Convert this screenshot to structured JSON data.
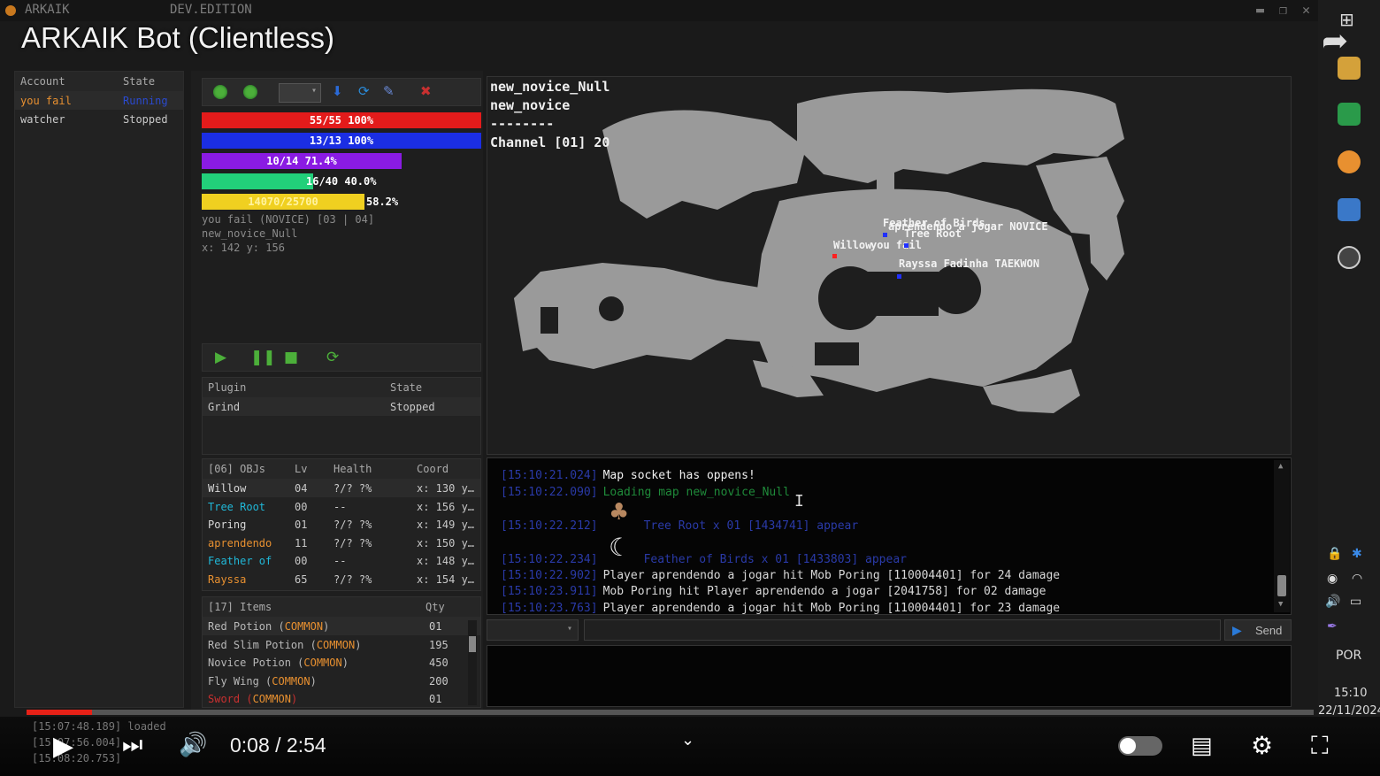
{
  "window": {
    "app_name": "ARKAIK",
    "edition": "DEV.EDITION",
    "video_title": "ARKAIK Bot (Clientless)"
  },
  "accounts": {
    "headers": [
      "Account",
      "State"
    ],
    "rows": [
      {
        "name": "you fail",
        "state": "Running"
      },
      {
        "name": "watcher",
        "state": "Stopped"
      }
    ]
  },
  "status": {
    "hp": "55/55 100%",
    "sp": "13/13 100%",
    "bar3": "10/14 71.4%",
    "bar3_fraction": 0.714,
    "bar4": "16/40 40.0%",
    "bar4_fraction": 0.4,
    "exp_partial": "14070/25700",
    "exp_pct": "58.2%",
    "exp_fraction": 0.582,
    "char_line": "you fail (NOVICE) [03 | 04]",
    "map_line": "new_novice_Null",
    "coords": "x: 142 y: 156"
  },
  "plugins": {
    "headers": [
      "Plugin",
      "State"
    ],
    "rows": [
      {
        "name": "Grind",
        "state": "Stopped"
      }
    ]
  },
  "objects": {
    "headers": [
      "[06] OBJs",
      "Lv",
      "Health",
      "Coord"
    ],
    "rows": [
      {
        "name": "Willow",
        "lv": "04",
        "health": "?/? ?%",
        "coord": "x: 130 y…",
        "color": "#d8d8d8"
      },
      {
        "name": "Tree Root",
        "lv": "00",
        "health": "--",
        "coord": "x: 156 y…",
        "color": "#20b8d8"
      },
      {
        "name": "Poring",
        "lv": "01",
        "health": "?/? ?%",
        "coord": "x: 149 y…",
        "color": "#d8d8d8"
      },
      {
        "name": "aprendendo",
        "lv": "11",
        "health": "?/? ?%",
        "coord": "x: 150 y…",
        "color": "#e89030"
      },
      {
        "name": "Feather of",
        "lv": "00",
        "health": "--",
        "coord": "x: 148 y…",
        "color": "#20b8d8"
      },
      {
        "name": "Rayssa",
        "lv": "65",
        "health": "?/? ?%",
        "coord": "x: 154 y…",
        "color": "#e89030"
      }
    ]
  },
  "items": {
    "headers": [
      "[17] Items",
      "Qty"
    ],
    "rows": [
      {
        "name": "Red Potion",
        "rarity": "COMMON",
        "qty": "01"
      },
      {
        "name": "Red Slim Potion",
        "rarity": "COMMON",
        "qty": "195"
      },
      {
        "name": "Novice Potion",
        "rarity": "COMMON",
        "qty": "450"
      },
      {
        "name": "Fly Wing",
        "rarity": "COMMON",
        "qty": "200"
      },
      {
        "name": "Sword",
        "rarity": "COMMON",
        "qty": "01"
      }
    ]
  },
  "map": {
    "name": "new_novice_Null",
    "subname": "new_novice",
    "separator": "--------",
    "channel": "Channel [01] 20",
    "labels": {
      "feather": "Feather of Birds",
      "aprendendo": "aprendendo a jogar NOVICE",
      "tree_root": "Tree Root",
      "willow": "Willow",
      "you": "you fail",
      "rayssa": "Rayssa Fadinha TAEKWON"
    }
  },
  "log": {
    "lines": [
      {
        "ts": "[15:10:21.024]",
        "msg": "Map socket has oppens!",
        "color": "#f0f0f0"
      },
      {
        "ts": "[15:10:22.090]",
        "msg": "Loading map new_novice_Null",
        "color": "#1f8a3a"
      },
      {
        "ts": "[15:10:22.212]",
        "msg": "Tree Root x 01 [1434741] appear",
        "color": "#2a3aa8"
      },
      {
        "ts": "[15:10:22.234]",
        "msg": "Feather of Birds x 01 [1433803] appear",
        "color": "#2a3aa8"
      },
      {
        "ts": "[15:10:22.902]",
        "msg": "Player aprendendo a jogar hit Mob Poring [110004401] for 24 damage",
        "color": "#d8d8d8"
      },
      {
        "ts": "[15:10:23.911]",
        "msg": "Mob Poring hit Player aprendendo a jogar [2041758] for 02 damage",
        "color": "#d8d8d8"
      },
      {
        "ts": "[15:10:23.763]",
        "msg": "Player aprendendo a jogar hit Mob Poring [110004401] for 23 damage",
        "color": "#d8d8d8"
      }
    ],
    "send_label": "Send",
    "bottom_lines": [
      "[15:07:48.189] loaded",
      "[15:07:56.004]",
      "[15:08:20.753]"
    ]
  },
  "player": {
    "time": "0:08 / 2:54",
    "progress_fraction": 0.051
  },
  "tray": {
    "lang": "POR",
    "clock": "15:10",
    "date": "22/11/2024"
  },
  "colors": {
    "hp": "#e31b1b",
    "sp": "#1b2ee3",
    "bar3": "#8a1be3",
    "bar4": "#22d07a",
    "exp": "#f0d020",
    "progress": "#e62117"
  }
}
